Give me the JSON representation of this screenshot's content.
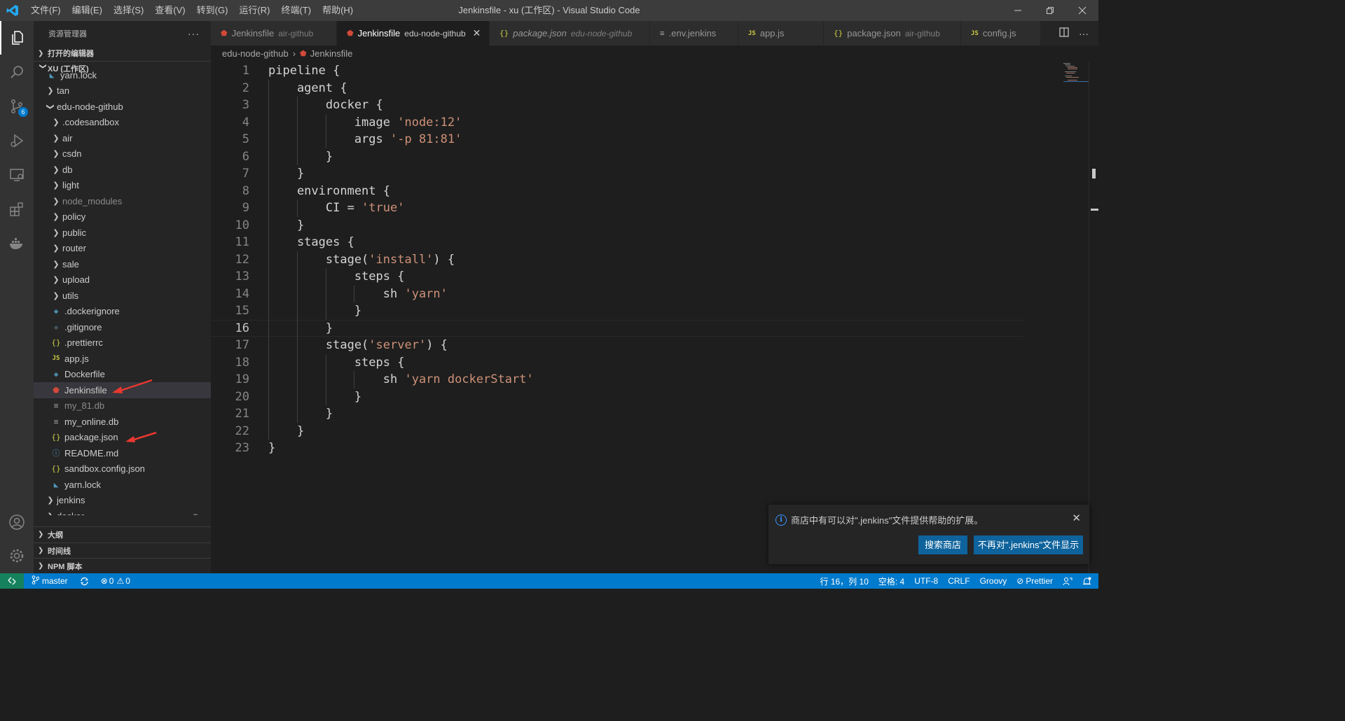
{
  "window": {
    "title": "Jenkinsfile - xu (工作区) - Visual Studio Code"
  },
  "menu": [
    "文件(F)",
    "编辑(E)",
    "选择(S)",
    "查看(V)",
    "转到(G)",
    "运行(R)",
    "终端(T)",
    "帮助(H)"
  ],
  "activity_bar": {
    "scm_badge": "6"
  },
  "sidebar": {
    "title": "资源管理器",
    "more": "···",
    "open_editors": "打开的编辑器",
    "workspace": "XU (工作区)",
    "tree": [
      {
        "label": "yarn.lock",
        "indent": 1,
        "icon": "yarn-icon"
      },
      {
        "label": "tan",
        "indent": 1,
        "folder": true
      },
      {
        "label": "edu-node-github",
        "indent": 1,
        "folder": true,
        "open": true
      },
      {
        "label": ".codesandbox",
        "indent": 2,
        "folder": true
      },
      {
        "label": "air",
        "indent": 2,
        "folder": true
      },
      {
        "label": "csdn",
        "indent": 2,
        "folder": true
      },
      {
        "label": "db",
        "indent": 2,
        "folder": true
      },
      {
        "label": "light",
        "indent": 2,
        "folder": true
      },
      {
        "label": "node_modules",
        "indent": 2,
        "folder": true,
        "dim": true
      },
      {
        "label": "policy",
        "indent": 2,
        "folder": true
      },
      {
        "label": "public",
        "indent": 2,
        "folder": true
      },
      {
        "label": "router",
        "indent": 2,
        "folder": true
      },
      {
        "label": "sale",
        "indent": 2,
        "folder": true
      },
      {
        "label": "upload",
        "indent": 2,
        "folder": true
      },
      {
        "label": "utils",
        "indent": 2,
        "folder": true
      },
      {
        "label": ".dockerignore",
        "indent": 2,
        "icon": "docker-icon"
      },
      {
        "label": ".gitignore",
        "indent": 2,
        "icon": "git-icon"
      },
      {
        "label": ".prettierrc",
        "indent": 2,
        "icon": "json-icon"
      },
      {
        "label": "app.js",
        "indent": 2,
        "icon": "js-icon"
      },
      {
        "label": "Dockerfile",
        "indent": 2,
        "icon": "docker-icon"
      },
      {
        "label": "Jenkinsfile",
        "indent": 2,
        "icon": "jenkins-icon",
        "selected": true
      },
      {
        "label": "my_81.db",
        "indent": 2,
        "icon": "file-lines-icon",
        "dim": true
      },
      {
        "label": "my_online.db",
        "indent": 2,
        "icon": "file-lines-icon"
      },
      {
        "label": "package.json",
        "indent": 2,
        "icon": "json-icon"
      },
      {
        "label": "README.md",
        "indent": 2,
        "icon": "info-icon"
      },
      {
        "label": "sandbox.config.json",
        "indent": 2,
        "icon": "json-icon"
      },
      {
        "label": "yarn.lock",
        "indent": 2,
        "icon": "yarn-icon"
      },
      {
        "label": "jenkins",
        "indent": 1,
        "folder": true
      },
      {
        "label": "docker",
        "indent": 1,
        "folder": true,
        "modified": true
      }
    ],
    "outline": "大纲",
    "timeline": "时间线",
    "npm_scripts": "NPM 脚本"
  },
  "tabs": [
    {
      "name": "Jenkinsfile",
      "desc": "air-github",
      "icon": "jenkins-icon"
    },
    {
      "name": "Jenkinsfile",
      "desc": "edu-node-github",
      "icon": "jenkins-icon",
      "active": true
    },
    {
      "name": "package.json",
      "desc": "edu-node-github",
      "icon": "json-icon",
      "italic": true
    },
    {
      "name": ".env.jenkins",
      "desc": "",
      "icon": "file-lines-icon"
    },
    {
      "name": "app.js",
      "desc": "",
      "icon": "js-icon"
    },
    {
      "name": "package.json",
      "desc": "air-github",
      "icon": "json-icon"
    },
    {
      "name": "config.js",
      "desc": "",
      "icon": "js-icon"
    }
  ],
  "breadcrumb": {
    "folder": "edu-node-github",
    "file": "Jenkinsfile"
  },
  "editor": {
    "current_line": 16,
    "lines": [
      [
        [
          "t",
          "pipeline {"
        ]
      ],
      [
        [
          "t",
          "    agent {"
        ]
      ],
      [
        [
          "t",
          "        docker {"
        ]
      ],
      [
        [
          "t",
          "            image "
        ],
        [
          "s",
          "'node:12'"
        ]
      ],
      [
        [
          "t",
          "            args "
        ],
        [
          "s",
          "'-p 81:81'"
        ]
      ],
      [
        [
          "t",
          "        }"
        ]
      ],
      [
        [
          "t",
          "    }"
        ]
      ],
      [
        [
          "t",
          "    environment {"
        ]
      ],
      [
        [
          "t",
          "        CI = "
        ],
        [
          "s",
          "'true'"
        ]
      ],
      [
        [
          "t",
          "    }"
        ]
      ],
      [
        [
          "t",
          "    stages {"
        ]
      ],
      [
        [
          "t",
          "        stage("
        ],
        [
          "s",
          "'install'"
        ],
        [
          "t",
          ") {"
        ]
      ],
      [
        [
          "t",
          "            steps {"
        ]
      ],
      [
        [
          "t",
          "                sh "
        ],
        [
          "s",
          "'yarn'"
        ]
      ],
      [
        [
          "t",
          "            }"
        ]
      ],
      [
        [
          "t",
          "        }"
        ]
      ],
      [
        [
          "t",
          "        stage("
        ],
        [
          "s",
          "'server'"
        ],
        [
          "t",
          ") {"
        ]
      ],
      [
        [
          "t",
          "            steps {"
        ]
      ],
      [
        [
          "t",
          "                sh "
        ],
        [
          "s",
          "'yarn dockerStart'"
        ]
      ],
      [
        [
          "t",
          "            }"
        ]
      ],
      [
        [
          "t",
          "        }"
        ]
      ],
      [
        [
          "t",
          "    }"
        ]
      ],
      [
        [
          "t",
          "}"
        ]
      ]
    ]
  },
  "notification": {
    "message": "商店中有可以对\".jenkins\"文件提供帮助的扩展。",
    "search_button": "搜索商店",
    "dont_show_button": "不再对\".jenkins\"文件显示"
  },
  "statusbar": {
    "branch": "master",
    "errors": "0",
    "warnings": "0",
    "position": "行 16，列 10",
    "spaces": "空格: 4",
    "encoding": "UTF-8",
    "eol": "CRLF",
    "language": "Groovy",
    "formatter": "Prettier"
  },
  "colors": {
    "accent": "#007acc",
    "string": "#ce9178",
    "remote": "#16825d"
  }
}
